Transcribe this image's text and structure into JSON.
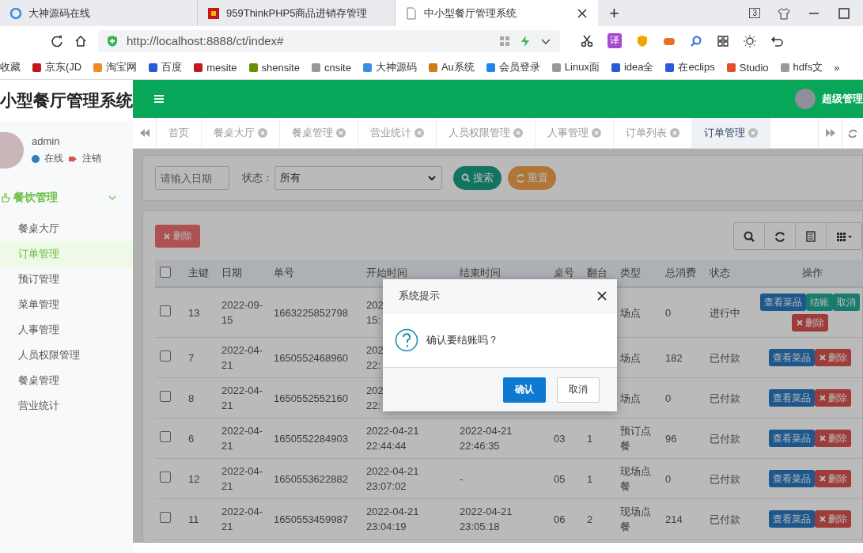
{
  "browser": {
    "tabs": [
      {
        "title": "大神源码在线",
        "selected": false
      },
      {
        "title": "959ThinkPHP5商品进销存管理",
        "selected": false
      },
      {
        "title": "中小型餐厅管理系统",
        "selected": true
      }
    ],
    "new_tab": "+",
    "tab_count": "3",
    "url": "http://localhost:8888/ct/index#",
    "translate": "译",
    "bookmarks": [
      "收藏",
      "京东(JD",
      "淘宝网",
      "百度",
      "mesite",
      "shensite",
      "cnsite",
      "大神源码",
      "Au系统",
      "会员登录",
      "Linux面",
      "idea全",
      "在eclips",
      "Studio",
      "hdfs文"
    ],
    "more": "»"
  },
  "app": {
    "title": "小型餐厅管理系统",
    "user": {
      "name": "admin",
      "status": "在线",
      "logout": "注销",
      "role": "超级管理"
    },
    "sidebar": {
      "group": {
        "label": "餐饮管理",
        "expanded": true,
        "items": [
          {
            "label": "餐桌大厅",
            "selected": false
          },
          {
            "label": "订单管理",
            "selected": true
          },
          {
            "label": "预订管理",
            "selected": false
          },
          {
            "label": "菜单管理",
            "selected": false
          },
          {
            "label": "人事管理",
            "selected": false
          },
          {
            "label": "人员权限管理",
            "selected": false
          },
          {
            "label": "餐桌管理",
            "selected": false
          },
          {
            "label": "营业统计",
            "selected": false
          }
        ]
      }
    },
    "tabs": [
      {
        "label": "首页",
        "closable": false,
        "selected": false
      },
      {
        "label": "餐桌大厅",
        "closable": true,
        "selected": false
      },
      {
        "label": "餐桌管理",
        "closable": true,
        "selected": false
      },
      {
        "label": "营业统计",
        "closable": true,
        "selected": false
      },
      {
        "label": "人员权限管理",
        "closable": true,
        "selected": false
      },
      {
        "label": "人事管理",
        "closable": true,
        "selected": false
      },
      {
        "label": "订单列表",
        "closable": true,
        "selected": false
      },
      {
        "label": "订单管理",
        "closable": true,
        "selected": true
      }
    ],
    "filter": {
      "date": {
        "placeholder": "请输入日期"
      },
      "status_label": "状态：",
      "status_value": "所有",
      "search": "搜索",
      "reset": "重置"
    },
    "toolbar": {
      "delete": "删除"
    },
    "table": {
      "select_all": false,
      "columns": [
        "主键",
        "日期",
        "单号",
        "开始时间",
        "结束时间",
        "桌号",
        "翻台",
        "类型",
        "总消费",
        "状态",
        "操作"
      ],
      "rows": [
        {
          "checked": false,
          "cells": [
            "13",
            "2022-09-15",
            "1663225852798",
            "202\n15:",
            "",
            "",
            "",
            "场点",
            "0",
            "进行中"
          ],
          "actions": [
            {
              "kind": "view",
              "label": "查看菜品"
            },
            {
              "kind": "checkout",
              "label": "结账"
            },
            {
              "kind": "cancel",
              "label": "取消"
            },
            {
              "kind": "delete",
              "label": "删除"
            }
          ]
        },
        {
          "checked": false,
          "cells": [
            "7",
            "2022-04-21",
            "1650552468960",
            "202\n22:",
            "",
            "",
            "",
            "场点",
            "182",
            "已付款"
          ],
          "actions": [
            {
              "kind": "view",
              "label": "查看菜品"
            },
            {
              "kind": "delete",
              "label": "删除"
            }
          ]
        },
        {
          "checked": false,
          "cells": [
            "8",
            "2022-04-21",
            "1650552552160",
            "202\n22:",
            "",
            "",
            "",
            "场点",
            "0",
            "已付款"
          ],
          "actions": [
            {
              "kind": "view",
              "label": "查看菜品"
            },
            {
              "kind": "delete",
              "label": "删除"
            }
          ]
        },
        {
          "checked": false,
          "cells": [
            "6",
            "2022-04-21",
            "1650552284903",
            "2022-04-21 22:44:44",
            "2022-04-21 22:46:35",
            "03",
            "1",
            "预订点餐",
            "96",
            "已付款"
          ],
          "actions": [
            {
              "kind": "view",
              "label": "查看菜品"
            },
            {
              "kind": "delete",
              "label": "删除"
            }
          ]
        },
        {
          "checked": false,
          "cells": [
            "12",
            "2022-04-21",
            "1650553622882",
            "2022-04-21 23:07:02",
            "-",
            "05",
            "1",
            "现场点餐",
            "0",
            "已付款"
          ],
          "actions": [
            {
              "kind": "view",
              "label": "查看菜品"
            },
            {
              "kind": "delete",
              "label": "删除"
            }
          ]
        },
        {
          "checked": false,
          "cells": [
            "11",
            "2022-04-21",
            "1650553459987",
            "2022-04-21 23:04:19",
            "2022-04-21 23:05:18",
            "06",
            "2",
            "现场点餐",
            "214",
            "已付款"
          ],
          "actions": [
            {
              "kind": "view",
              "label": "查看菜品"
            },
            {
              "kind": "delete",
              "label": "删除"
            }
          ]
        }
      ]
    }
  },
  "dialog": {
    "title": "系统提示",
    "message": "确认要结账吗？",
    "confirm": "确认",
    "cancel": "取消"
  }
}
